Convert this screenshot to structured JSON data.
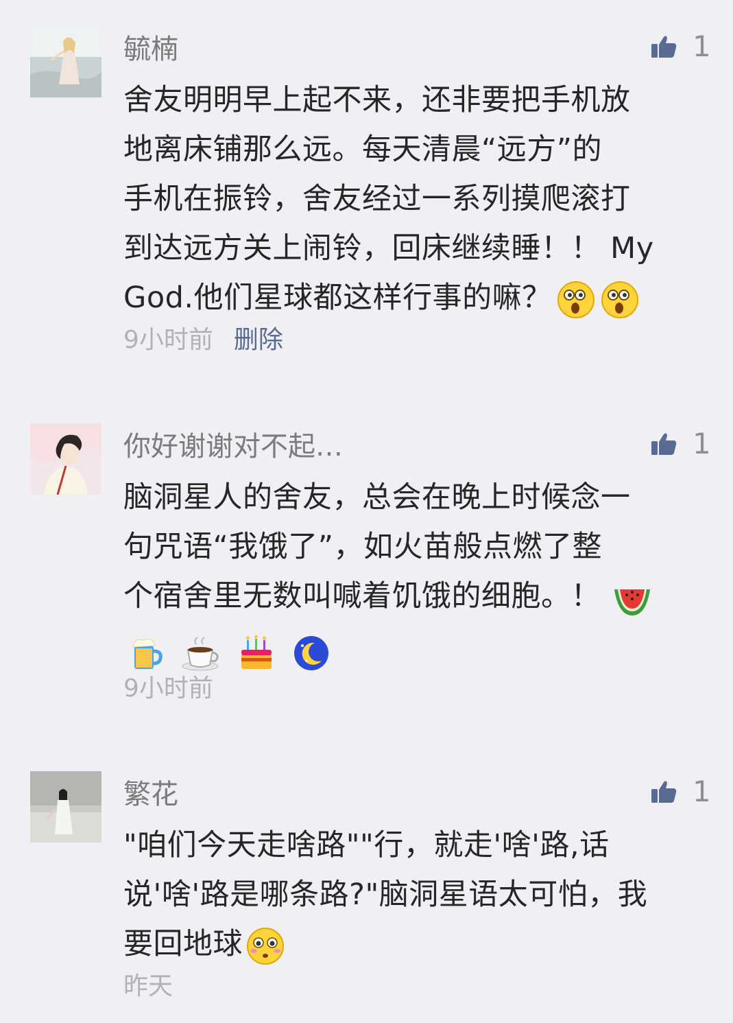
{
  "comments": [
    {
      "username": "毓楠",
      "avatar": "beach-girl-photo",
      "likes": "1",
      "lines": [
        "舍友明明早上起不来，还非要把手机放",
        "地离床铺那么远。每天清晨“远方”的",
        "手机在振铃，舍友经过一系列摸爬滚打",
        "到达远方关上闹铃，回床继续睡！！ My",
        "God.他们星球都这样行事的嘛？"
      ],
      "trailing_emojis": [
        "shocked-face-emoji",
        "shocked-face-emoji"
      ],
      "time": "9小时前",
      "delete_label": "删除"
    },
    {
      "username": "你好谢谢对不起…",
      "avatar": "short-hair-girl-illustration",
      "likes": "1",
      "lines": [
        "脑洞星人的舍友，总会在晚上时候念一",
        "句咒语“我饿了”，如火苗般点燃了整",
        "个宿舍里无数叫喊着饥饿的细胞。！"
      ],
      "inline_emoji": "watermelon-emoji",
      "emoji_row": [
        "beer-emoji",
        "coffee-emoji",
        "cake-emoji",
        "moon-emoji"
      ],
      "time": "9小时前"
    },
    {
      "username": "繁花",
      "avatar": "girl-white-dress-photo",
      "likes": "1",
      "lines": [
        "\"咱们今天走啥路\"\"行，就走'啥'路,话",
        "说'啥'路是哪条路?\"脑洞星语太可怕，我",
        "要回地球"
      ],
      "trailing_emojis": [
        "flushed-face-emoji"
      ],
      "time": "昨天"
    }
  ],
  "colors": {
    "background": "#efeff4",
    "username": "#7b7b7b",
    "body_text": "#262626",
    "time": "#b2b2b2",
    "link": "#576b95",
    "like_icon": "#576b95"
  }
}
